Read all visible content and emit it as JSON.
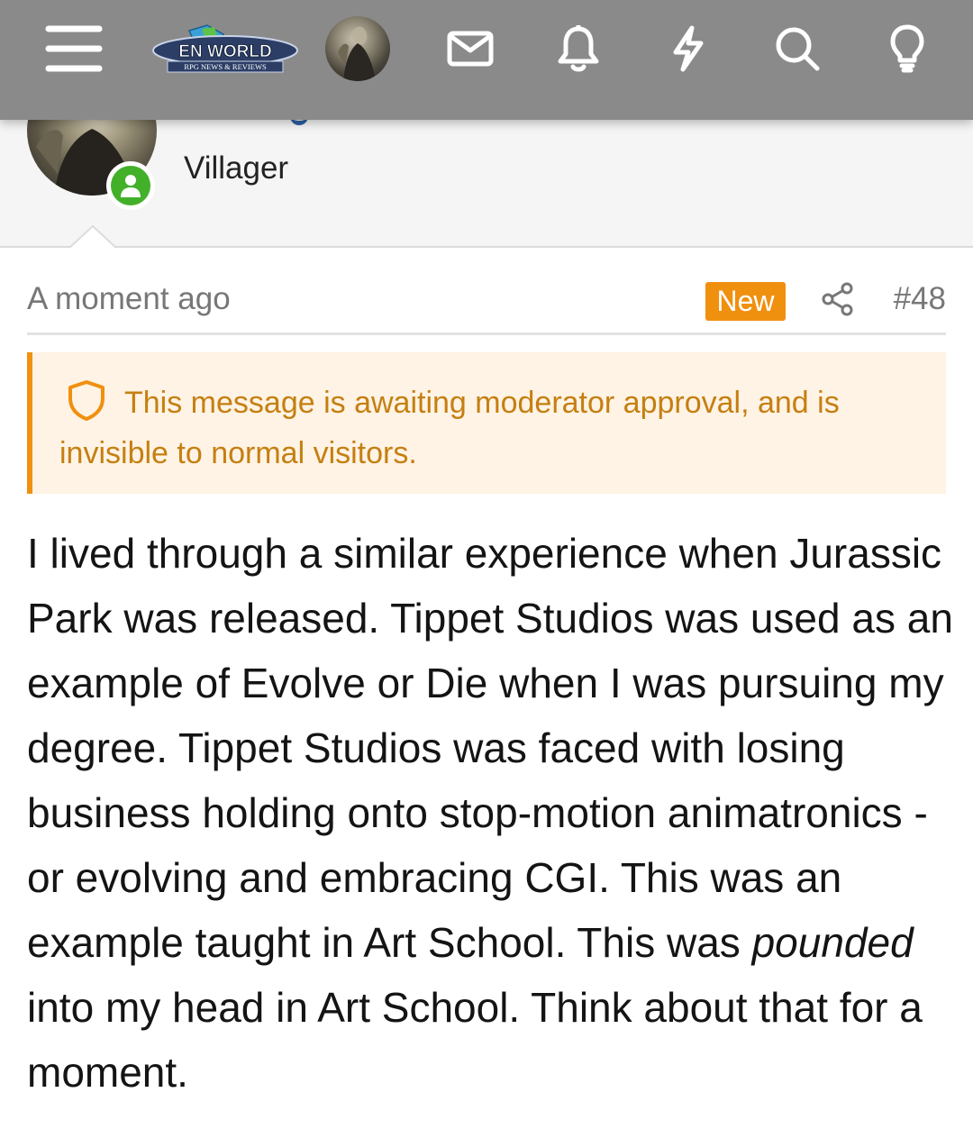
{
  "nav": {
    "menu_icon": "hamburger-icon",
    "logo_text": "EN WORLD",
    "logo_subtext": "RPG NEWS & REVIEWS",
    "icons": [
      "envelope-icon",
      "bell-icon",
      "lightning-icon",
      "search-icon",
      "lightbulb-icon"
    ]
  },
  "member": {
    "user_title": "Villager",
    "status": "online"
  },
  "post": {
    "time": "A moment ago",
    "badge": "New",
    "number": "#48",
    "notice": "This message is awaiting moderator approval, and is invisible to normal visitors.",
    "body_part1": "I lived through a similar experience when Jurassic Park was released. Tippet Studios was used as an example of Evolve or Die when I was pursuing my degree. Tippet Studios was faced with losing business holding onto stop-motion animatronics - or evolving and embracing CGI. This was an example taught in Art School. This was ",
    "body_emphasis": "pounded",
    "body_part2": " into my head in Art School. Think about that for a moment."
  },
  "colors": {
    "topbar": "#8a8a8a",
    "accent_orange": "#f0900f",
    "notice_bg": "#fef3e4",
    "notice_text": "#c57f11",
    "online_green": "#43b02a"
  }
}
